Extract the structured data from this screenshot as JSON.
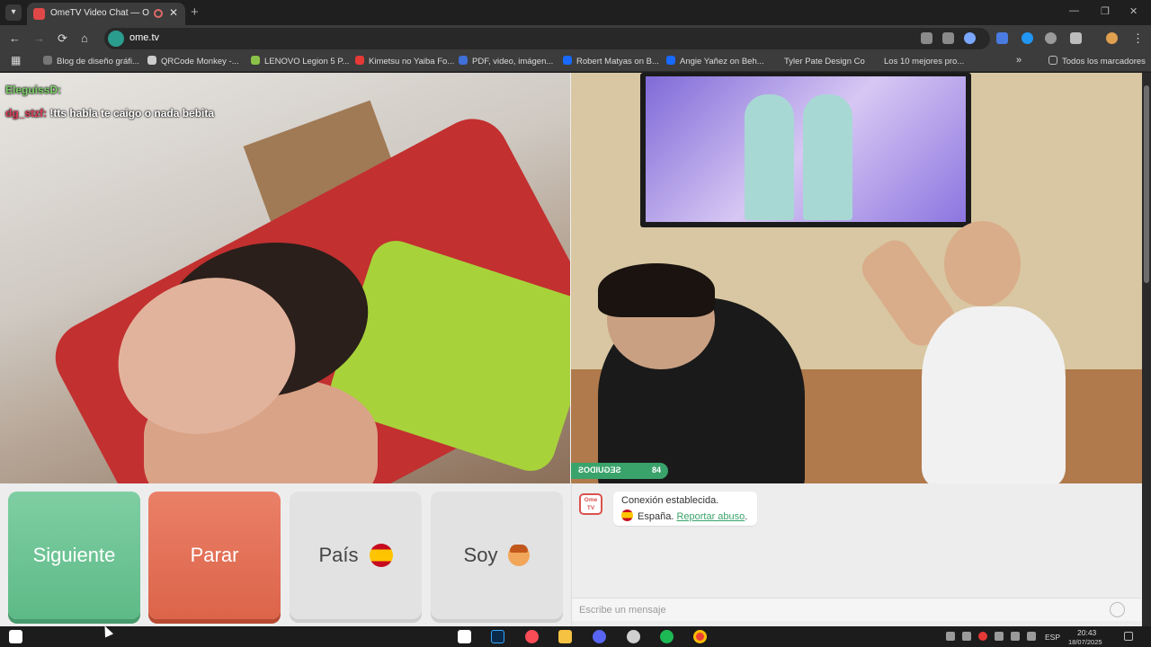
{
  "browser": {
    "tab_title": "OmeTV Video Chat — Ome",
    "tab_close": "✕",
    "new_tab": "+",
    "url": "ome.tv",
    "window_controls": [
      "—",
      "❐",
      "✕"
    ],
    "nav_back": "←",
    "nav_forward": "→",
    "nav_reload": "⟳",
    "nav_home": "⌂",
    "bookmarks_overflow": "»",
    "bookmarks": [
      {
        "label": "Blog de diseño gráfi...",
        "color": "#777777"
      },
      {
        "label": "QRCode Monkey -...",
        "color": "#cccccc"
      },
      {
        "label": "LENOVO Legion 5 P...",
        "color": "#8bc34a"
      },
      {
        "label": "Kimetsu no Yaiba Fo...",
        "color": "#e53935"
      },
      {
        "label": "PDF, video, imágen...",
        "color": "#3f6fd8"
      },
      {
        "label": "Robert Matyas on B...",
        "color": "#1769ff"
      },
      {
        "label": "Angie Yañez on Beh...",
        "color": "#1769ff"
      },
      {
        "label": "Tyler Pate Design Co",
        "color": "#3c3c3c"
      },
      {
        "label": "Los 10 mejores pro...",
        "color": "#3c3c3c"
      }
    ],
    "all_bookmarks": "Todos los marcadores"
  },
  "stream_overlay": {
    "line1_user": "EleguissD:",
    "line2_user": "dg_stzf:",
    "line2_text": "!tts habla te caigo o nada bebita"
  },
  "follow_badge": {
    "count": "84",
    "label": "SEGUIDOS"
  },
  "controls": {
    "next": "Siguiente",
    "stop": "Parar",
    "country": "País",
    "me": "Soy"
  },
  "chat": {
    "logo_line1": "Ome",
    "logo_line2": "TV",
    "system_msg": "Conexión establecida.",
    "country": "España.",
    "report": "Reportar abuso",
    "placeholder": "Escribe un mensaje"
  },
  "taskbar": {
    "lang": "ESP",
    "time": "20:43",
    "date": "18/07/2025"
  },
  "colors": {
    "next": "#5dba87",
    "stop": "#dc6449",
    "accent": "#3aa36b"
  }
}
